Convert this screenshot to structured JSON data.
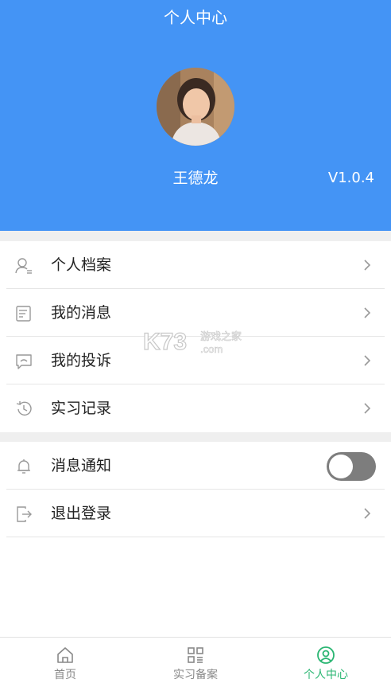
{
  "header": {
    "title": "个人中心",
    "user_name": "王德龙",
    "version": "V1.0.4",
    "background_color": "#4494f5"
  },
  "menu": {
    "group1": [
      {
        "label": "个人档案",
        "icon": "user-profile-icon"
      },
      {
        "label": "我的消息",
        "icon": "message-icon"
      },
      {
        "label": "我的投诉",
        "icon": "complaint-icon"
      },
      {
        "label": "实习记录",
        "icon": "history-icon"
      }
    ],
    "group2": {
      "notify_label": "消息通知",
      "notify_enabled": false,
      "logout_label": "退出登录"
    }
  },
  "watermark": {
    "brand": "K73",
    "text": "游戏之家",
    "domain": ".com"
  },
  "tabbar": {
    "tabs": [
      {
        "label": "首页",
        "icon": "home-icon",
        "active": false
      },
      {
        "label": "实习备案",
        "icon": "grid-icon",
        "active": false
      },
      {
        "label": "个人中心",
        "icon": "user-circle-icon",
        "active": true
      }
    ],
    "active_color": "#2bb673"
  }
}
